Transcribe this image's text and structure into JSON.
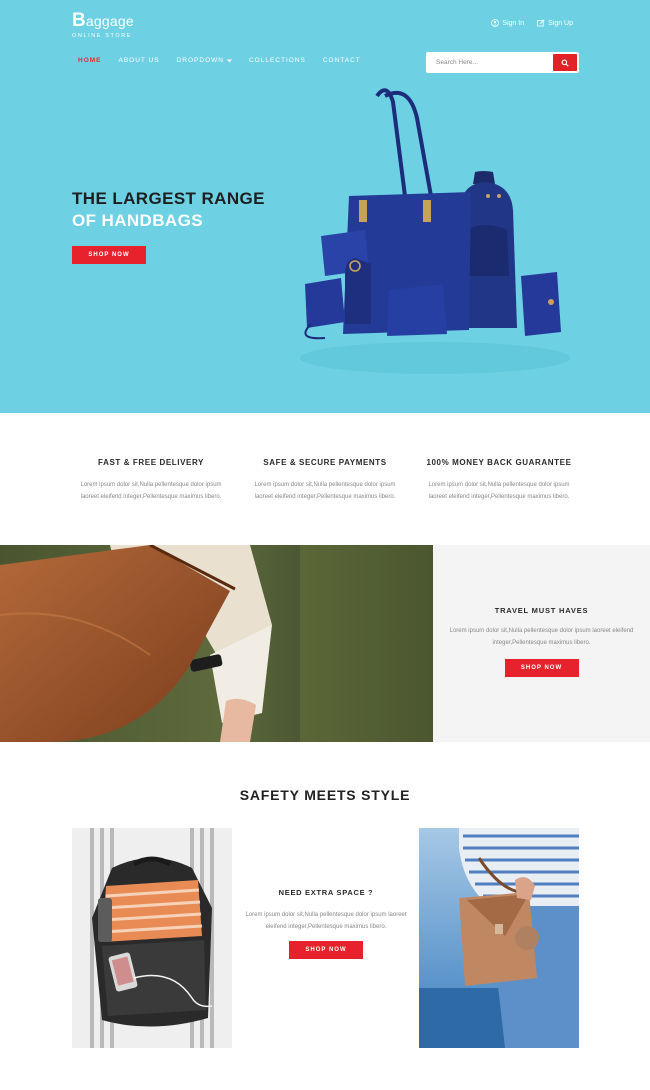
{
  "brand": {
    "name_initial": "B",
    "name_rest": "aggage",
    "tagline": "ONLINE STORE"
  },
  "top_links": [
    {
      "label": "Sign In",
      "icon": "user-icon"
    },
    {
      "label": "Sign Up",
      "icon": "edit-icon"
    }
  ],
  "nav": {
    "home": "HOME",
    "about": "ABOUT US",
    "dropdown": "DROPDOWN",
    "collections": "COLLECTIONS",
    "contact": "CONTACT"
  },
  "search": {
    "placeholder": "Search Here...",
    "icon": "search-icon"
  },
  "hero": {
    "title_line1": "THE LARGEST RANGE",
    "title_line2": "OF HANDBAGS",
    "button": "SHOP NOW"
  },
  "features": [
    {
      "title": "FAST & FREE DELIVERY",
      "text": "Lorem ipsum dolor sit,Nulla pellentesque dolor ipsum laoreet eleifend integer,Pellentesque maximus libero."
    },
    {
      "title": "SAFE & SECURE PAYMENTS",
      "text": "Lorem ipsum dolor sit,Nulla pellentesque dolor ipsum laoreet eleifend integer,Pellentesque maximus libero."
    },
    {
      "title": "100% MONEY BACK GUARANTEE",
      "text": "Lorem ipsum dolor sit,Nulla pellentesque dolor ipsum laoreet eleifend integer,Pellentesque maximus libero."
    }
  ],
  "travel": {
    "title": "TRAVEL MUST HAVES",
    "text": "Lorem ipsum dolor sit,Nulla pellentesque dolor ipsum laoreet eleifend integer,Pellentesque maximus libero.",
    "button": "SHOP NOW"
  },
  "safety": {
    "title": "SAFETY MEETS STYLE",
    "block_title": "NEED EXTRA SPACE ?",
    "block_text": "Lorem ipsum dolor sit,Nulla pellentesque dolor ipsum laoreet eleifend integer,Pellentesque maximus libero.",
    "button": "SHOP NOW"
  },
  "colors": {
    "hero_bg": "#6dd0e3",
    "accent_red": "#e8222c",
    "panel_bg": "#f4f4f4"
  }
}
